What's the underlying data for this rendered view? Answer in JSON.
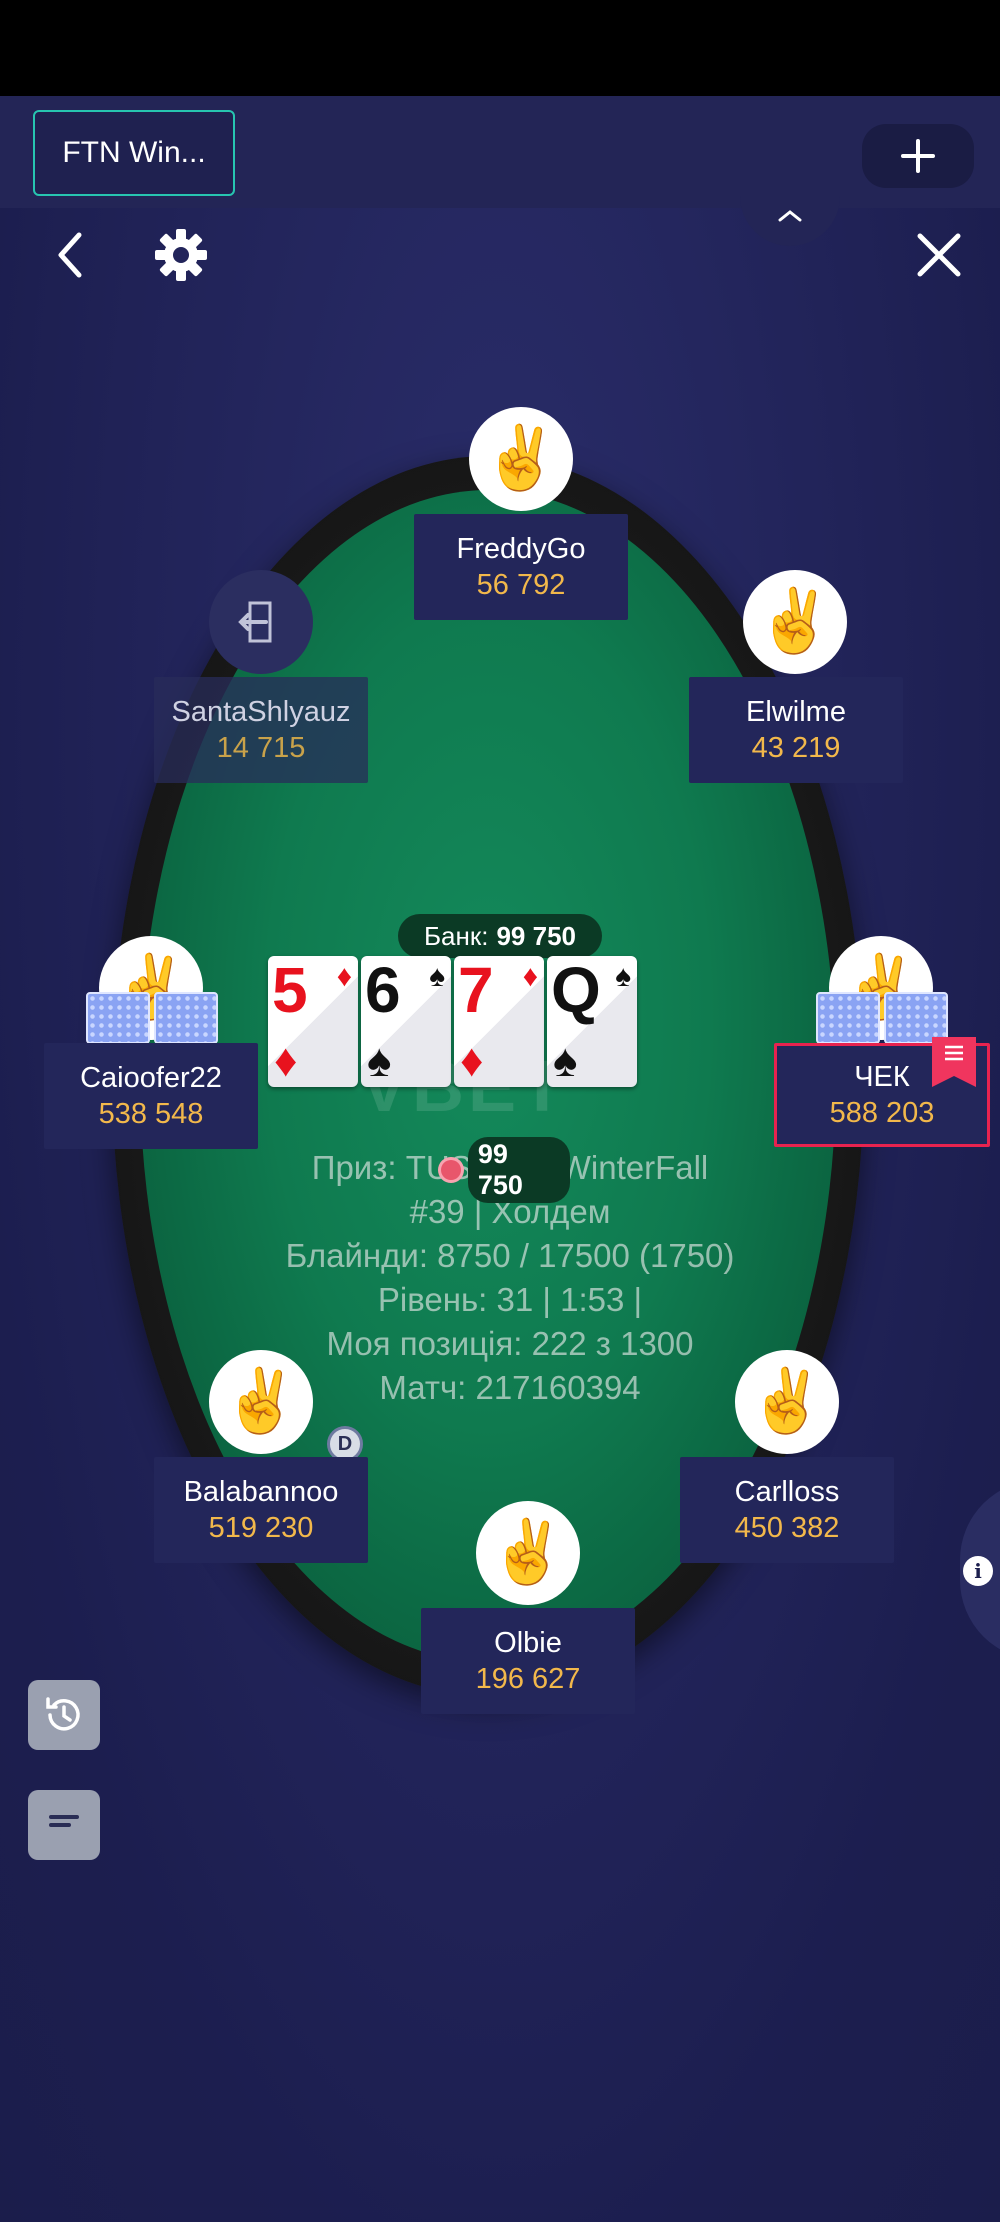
{
  "tab": {
    "title": "FTN Win..."
  },
  "header": {
    "add_label": "+",
    "collapse_label": "^"
  },
  "pot": {
    "label": "Банк:",
    "amount": "99 750"
  },
  "board": [
    {
      "rank": "5",
      "suit": "♦",
      "color": "red"
    },
    {
      "rank": "6",
      "suit": "♠",
      "color": "black"
    },
    {
      "rank": "7",
      "suit": "♦",
      "color": "red"
    },
    {
      "rank": "Q",
      "suit": "♠",
      "color": "black"
    }
  ],
  "watermark": "VBET",
  "info": {
    "line1": "Приз: TUS 1...N WinterFall",
    "line2": "#39 | Холдем",
    "line3": "Блайнди: 8750 / 17500 (1750)",
    "line4": "Рівень: 31 | 1:53 |",
    "line5": "Моя позиція: 222 з 1300",
    "line6": "Матч: 217160394"
  },
  "center_bet": "99 750",
  "dealer_label": "D",
  "players": {
    "freddygo": {
      "name": "FreddyGo",
      "stack": "56 792"
    },
    "santashlyauz": {
      "name": "SantaShlyauz",
      "stack": "14 715"
    },
    "elwilme": {
      "name": "Elwilme",
      "stack": "43 219"
    },
    "caioofer22": {
      "name": "Caioofer22",
      "stack": "538 548"
    },
    "chek": {
      "name": "ЧЕК",
      "stack": "588 203"
    },
    "balabannoo": {
      "name": "Balabannoo",
      "stack": "519 230"
    },
    "carlloss": {
      "name": "Carlloss",
      "stack": "450 382"
    },
    "olbie": {
      "name": "Olbie",
      "stack": "196 627"
    }
  },
  "avatar_emoji": "✌️",
  "colors": {
    "accent_teal": "#27c5b0",
    "stack_gold": "#f2b84b",
    "felt_green": "#0f7a4f",
    "active_red": "#e8234f"
  }
}
